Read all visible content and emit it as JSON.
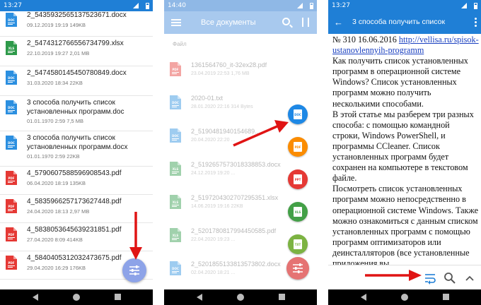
{
  "phone1": {
    "status_time": "13:27",
    "files": [
      {
        "name": "2_5435932565137523671.docx",
        "meta": "09.12.2019 19:19   149KB",
        "type": "docx"
      },
      {
        "name": "2_5474312766556734799.xlsx",
        "meta": "22.10.2019 19:27   2,01 MB",
        "type": "xlsx"
      },
      {
        "name": "2_5474580145450780849.docx",
        "meta": "31.03.2020 18:34   22KB",
        "type": "docx"
      },
      {
        "name": "3 способа получить список",
        "name2": "установленных программ.doc",
        "meta": "01.01.1970 2:59   7,5 MB",
        "type": "docx"
      },
      {
        "name": "3 способа получить список",
        "name2": "установленных программ.docx",
        "meta": "01.01.1970 2:59   22KB",
        "type": "docx"
      },
      {
        "name": "4_5790607588596908543.pdf",
        "meta": "06.04.2020 18:19   135KB",
        "type": "pdf"
      },
      {
        "name": "4_5835966257173627448.pdf",
        "meta": "24.04.2020 18:13   2,97 MB",
        "type": "pdf"
      },
      {
        "name": "4_5838053645639231851.pdf",
        "meta": "27.04.2020 8:09   414KB",
        "type": "pdf"
      },
      {
        "name": "4_5840405312032473675.pdf",
        "meta": "29.04.2020 16:29   176KB",
        "type": "pdf"
      }
    ]
  },
  "phone2": {
    "status_time": "14:40",
    "title": "Все документы",
    "section": "Файл",
    "files": [
      {
        "name": "1361564760_it-32ex28.pdf",
        "meta": "23.04.2019 22:53   1,76 MB",
        "type": "pdf"
      },
      {
        "name": "2020-01.txt",
        "meta": "28.01.2020 22:16   314 Bytes",
        "type": "docx"
      },
      {
        "name": "2_5190481940154689...",
        "meta": "20.04.2020 22:20   ...",
        "type": "docx"
      },
      {
        "name": "2_5192657573018338853.docx",
        "meta": "24.12.2019 19:20   ...",
        "type": "xlsx"
      },
      {
        "name": "2_5197204302707295351.xlsx",
        "meta": "14.06.2019 19:16   22KB",
        "type": "xlsx"
      },
      {
        "name": "2_5201780817994450585.pdf",
        "meta": "22.04.2020 19:23   ...",
        "type": "xlsx"
      },
      {
        "name": "2_5201855133813573802.docx",
        "meta": "02.04.2020 18:21   ...",
        "type": "docx"
      }
    ],
    "fab_labels": [
      "DOC",
      "PDF",
      "PPT",
      "XLS",
      "TXT"
    ],
    "colors": {
      "doc": "#1e88e5",
      "pdf": "#fb8c00",
      "ppt": "#e53935",
      "xls": "#43a047",
      "txt": "#7cb342",
      "filter": "#e57373"
    }
  },
  "phone3": {
    "status_time": "13:27",
    "title": "3 способа получить список",
    "text_before_link": "№ 310 16.06.2016 ",
    "link": "http://vellisa.ru/spisok-ustanovlennyih-programm",
    "paragraphs": [
      "Как получить список установленных программ в операционной системе Windows? Список установленных программ можно получить несколькими способами.",
      "В этой статье мы разберем три разных способа: с помощью командной строки, Windows PowerShell, и программы CCleaner. Список установленных программ будет сохранен на компьютере в текстовом файле.",
      "Посмотреть список установленных программ можно непосредственно в операционной системе Windows. Также можно ознакомиться с данным списком установленных программ с помощью программ оптимизаторов или деинсталляторов (все установленные приложения вы"
    ]
  },
  "colors": {
    "primary": "#1f7fd6",
    "arrow": "#e01414",
    "docx": "#2b8fe0",
    "xlsx": "#2e9a4a",
    "pdf": "#e53935"
  }
}
